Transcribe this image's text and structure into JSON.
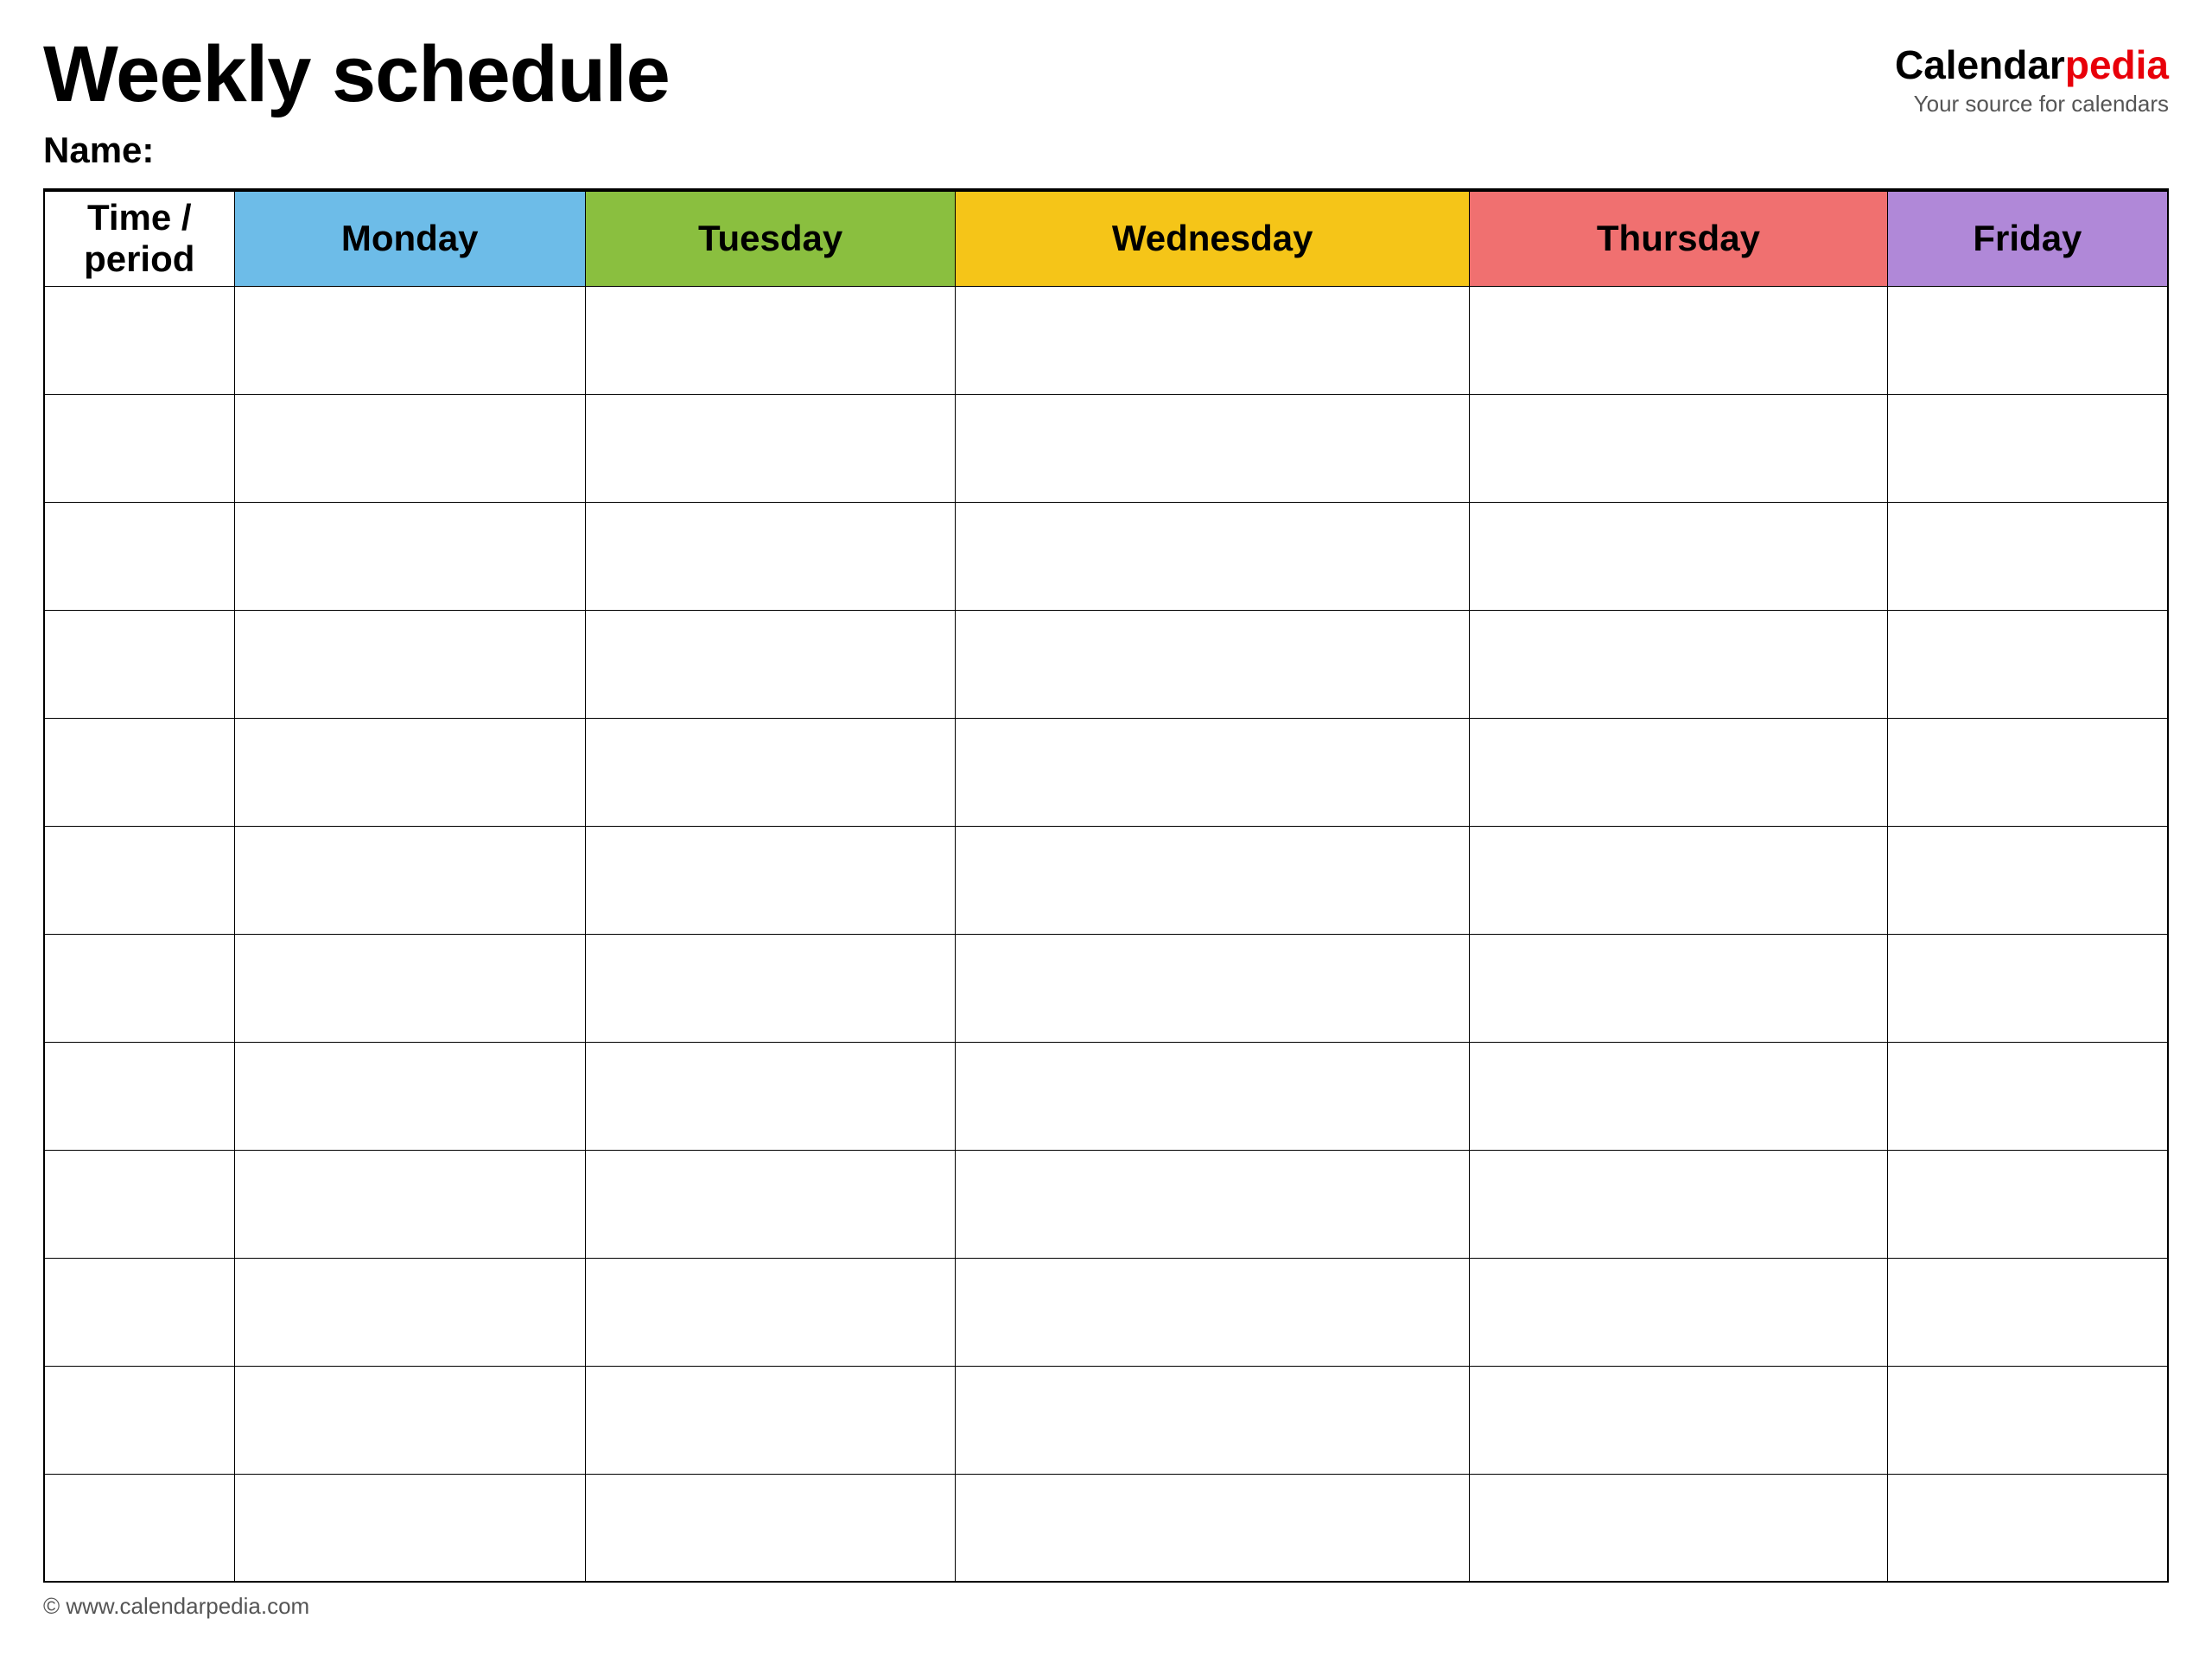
{
  "header": {
    "title": "Weekly schedule",
    "name_label": "Name:",
    "logo_calendar": "Calendar",
    "logo_pedia": "pedia",
    "logo_tagline": "Your source for calendars",
    "footer_url": "© www.calendarpedia.com"
  },
  "table": {
    "columns": [
      {
        "id": "time",
        "label": "Time / period",
        "color": "#ffffff"
      },
      {
        "id": "monday",
        "label": "Monday",
        "color": "#6dbce8"
      },
      {
        "id": "tuesday",
        "label": "Tuesday",
        "color": "#8abf3f"
      },
      {
        "id": "wednesday",
        "label": "Wednesday",
        "color": "#f5c518"
      },
      {
        "id": "thursday",
        "label": "Thursday",
        "color": "#f07070"
      },
      {
        "id": "friday",
        "label": "Friday",
        "color": "#b088d8"
      }
    ],
    "row_count": 12
  }
}
